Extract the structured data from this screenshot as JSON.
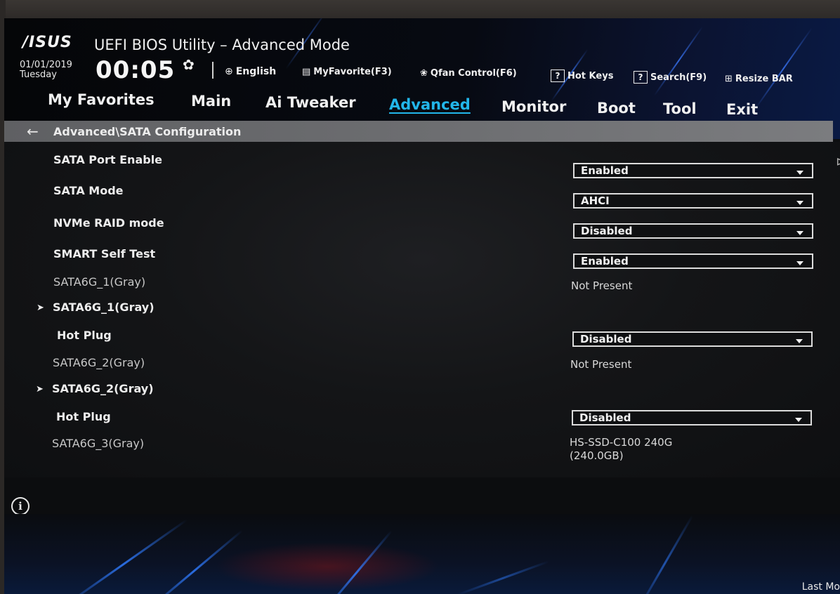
{
  "header": {
    "brand": "/ISUS",
    "app_title": "UEFI BIOS Utility – Advanced Mode",
    "date": "01/01/2019",
    "weekday": "Tuesday",
    "time": "00:05",
    "toolbar": {
      "language": "English",
      "myfavorite": "MyFavorite(F3)",
      "qfan": "Qfan Control(F6)",
      "hotkeys": "Hot Keys",
      "search": "Search(F9)",
      "resize_bar": "Resize BAR"
    }
  },
  "tabs": [
    {
      "label": "My Favorites"
    },
    {
      "label": "Main"
    },
    {
      "label": "Ai Tweaker"
    },
    {
      "label": "Advanced",
      "active": true
    },
    {
      "label": "Monitor"
    },
    {
      "label": "Boot"
    },
    {
      "label": "Tool"
    },
    {
      "label": "Exit"
    }
  ],
  "breadcrumb": "Advanced\\SATA Configuration",
  "settings": [
    {
      "label": "SATA Port Enable",
      "value": "Enabled"
    },
    {
      "label": "SATA Mode",
      "value": "AHCI"
    },
    {
      "label": "NVMe RAID mode",
      "value": "Disabled"
    },
    {
      "label": "SMART Self Test",
      "value": "Enabled"
    },
    {
      "label": "SATA6G_1(Gray)",
      "value": "Not Present"
    },
    {
      "label": "SATA6G_1(Gray)"
    },
    {
      "label": "Hot Plug",
      "value": "Disabled"
    },
    {
      "label": "SATA6G_2(Gray)",
      "value": "Not Present"
    },
    {
      "label": "SATA6G_2(Gray)"
    },
    {
      "label": "Hot Plug",
      "value": "Disabled"
    },
    {
      "label": "SATA6G_3(Gray)",
      "value_line1": "HS-SSD-C100 240G",
      "value_line2": "(240.0GB)"
    }
  ],
  "footer": {
    "last_modified": "Last Mo"
  },
  "colors": {
    "accent": "#22b6ea",
    "background": "#0d0e10",
    "breadcrumb_bar": "#6f7073"
  }
}
